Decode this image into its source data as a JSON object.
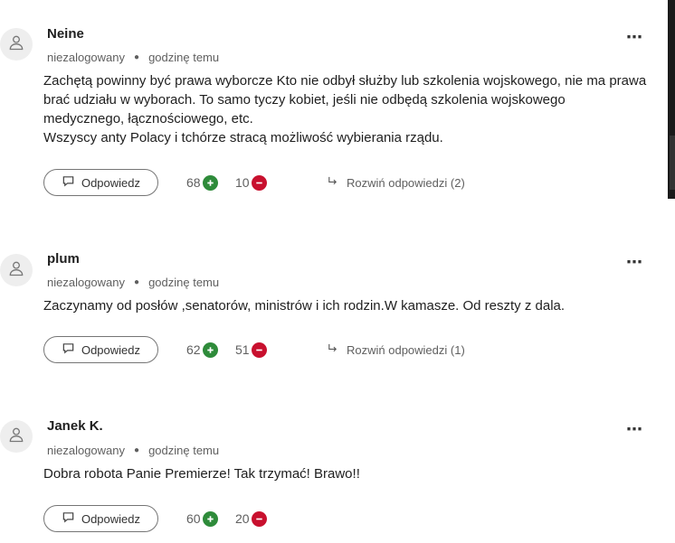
{
  "colors": {
    "upvote": "#2e8b3a",
    "downvote": "#c8102e",
    "text": "#1f1f1f",
    "muted": "#5f5f5f"
  },
  "icons": {
    "avatar": "user-icon",
    "more": "more-horizontal-icon",
    "reply": "comment-icon",
    "upvote": "plus-circle-icon",
    "downvote": "minus-circle-icon",
    "expand": "reply-arrow-icon"
  },
  "comments": [
    {
      "author": "Neine",
      "status": "niezalogowany",
      "time": "godzinę temu",
      "more": "⋯",
      "text": [
        "Zachętą powinny być prawa wyborcze Kto nie odbył służby lub szkolenia wojskowego, nie ma prawa brać udziału w wyborach. To samo tyczy kobiet, jeśli nie odbędą szkolenia wojskowego medycznego, łącznościowego, etc.",
        "Wszyscy anty Polacy i tchórze stracą możliwość wybierania rządu."
      ],
      "reply_label": "Odpowiedz",
      "upvotes": "68",
      "downvotes": "10",
      "expand_label": "Rozwiń odpowiedzi (2)"
    },
    {
      "author": "plum",
      "status": "niezalogowany",
      "time": "godzinę temu",
      "more": "⋯",
      "text": [
        "Zaczynamy od posłów ,senatorów, ministrów i ich rodzin.W kamasze. Od reszty z dala."
      ],
      "reply_label": "Odpowiedz",
      "upvotes": "62",
      "downvotes": "51",
      "expand_label": "Rozwiń odpowiedzi (1)"
    },
    {
      "author": "Janek K.",
      "status": "niezalogowany",
      "time": "godzinę temu",
      "more": "⋯",
      "text": [
        "Dobra robota Panie Premierze! Tak trzymać! Brawo!!"
      ],
      "reply_label": "Odpowiedz",
      "upvotes": "60",
      "downvotes": "20"
    }
  ]
}
